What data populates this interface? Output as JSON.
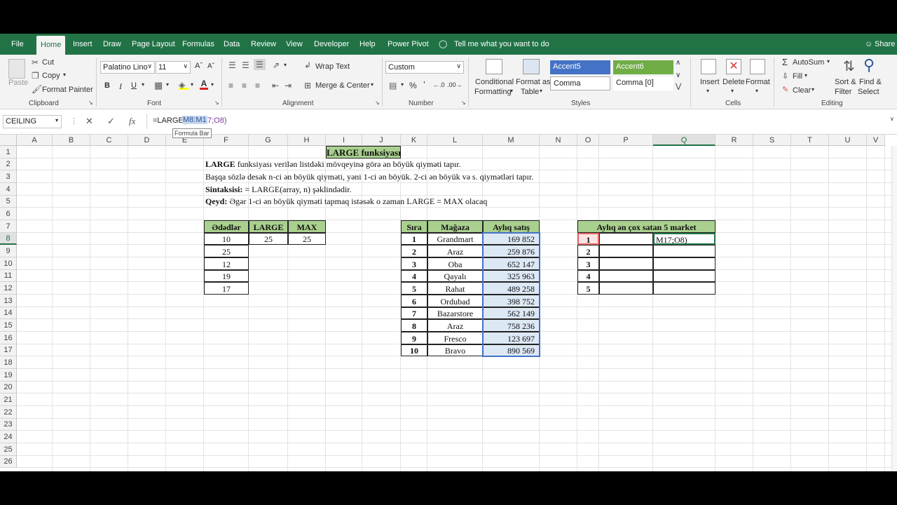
{
  "tabs": [
    "File",
    "Home",
    "Insert",
    "Draw",
    "Page Layout",
    "Formulas",
    "Data",
    "Review",
    "View",
    "Developer",
    "Help",
    "Power Pivot"
  ],
  "tell_me": "Tell me what you want to do",
  "share": "Share",
  "ribbon": {
    "clipboard": {
      "paste": "Paste",
      "cut": "Cut",
      "copy": "Copy",
      "format_painter": "Format Painter",
      "group": "Clipboard"
    },
    "font": {
      "name": "Palatino Lino",
      "size": "11",
      "bold": "B",
      "italic": "I",
      "underline": "U",
      "group": "Font"
    },
    "alignment": {
      "wrap": "Wrap Text",
      "merge": "Merge & Center",
      "group": "Alignment"
    },
    "number": {
      "format": "Custom",
      "group": "Number"
    },
    "styles": {
      "conditional": [
        "Conditional",
        "Formatting"
      ],
      "format_table": [
        "Format as",
        "Table"
      ],
      "accent5": "Accent5",
      "accent6": "Accent6",
      "comma": "Comma",
      "comma0": "Comma [0]",
      "group": "Styles"
    },
    "cells": {
      "insert": "Insert",
      "delete": "Delete",
      "format": "Format",
      "group": "Cells"
    },
    "editing": {
      "autosum": "AutoSum",
      "fill": "Fill",
      "clear": "Clear",
      "sort": [
        "Sort &",
        "Filter"
      ],
      "find": [
        "Find &",
        "Select"
      ],
      "group": "Editing"
    },
    "colors": {
      "accent5": "#4472c4",
      "accent6": "#70ad47",
      "green": "#217346"
    }
  },
  "formula_bar": {
    "name_box": "CEILING",
    "formula_pre": "=LARGE(",
    "formula_sel": "M8:M1",
    "formula_post": "7;O8)",
    "tooltip": "Formula Bar"
  },
  "columns": [
    "A",
    "B",
    "C",
    "D",
    "E",
    "F",
    "G",
    "H",
    "I",
    "J",
    "K",
    "L",
    "M",
    "N",
    "O",
    "P",
    "Q",
    "R",
    "S",
    "T",
    "U",
    "V"
  ],
  "rows": [
    "1",
    "2",
    "3",
    "4",
    "5",
    "6",
    "7",
    "8",
    "9",
    "10",
    "11",
    "12",
    "13",
    "14",
    "15",
    "16",
    "17",
    "18",
    "19",
    "20",
    "21",
    "22",
    "23",
    "24",
    "25",
    "26"
  ],
  "sheet": {
    "title": "LARGE funksiyası",
    "line2_bold": "LARGE",
    "line2": " funksiyası verilən listdəki mövqeyinə görə ən böyük qiyməti tapır.",
    "line3": "Başqa sözlə desək n-ci ən böyük qiyməti, yəni 1-ci ən böyük. 2-ci ən böyük və s. qiymətləri tapır.",
    "line4_bold": "Sintaksisi:",
    "line4": " = LARGE(array, n) şəklindədir.",
    "line5_bold": "Qeyd:",
    "line5": " Əgər 1-ci ən böyük qiyməti tapmaq istəsək o zaman LARGE = MAX olacaq",
    "t1": {
      "headers": [
        "Ədədlər",
        "LARGE",
        "MAX"
      ],
      "numbers": [
        "10",
        "25",
        "12",
        "19",
        "17"
      ],
      "large": "25",
      "max": "25"
    },
    "t2": {
      "headers": [
        "Sıra",
        "Mağaza",
        "Aylıq satış"
      ],
      "rows": [
        [
          "1",
          "Grandmart",
          "169 852"
        ],
        [
          "2",
          "Araz",
          "259 876"
        ],
        [
          "3",
          "Oba",
          "652 147"
        ],
        [
          "4",
          "Qayalı",
          "325 963"
        ],
        [
          "5",
          "Rahat",
          "489 258"
        ],
        [
          "6",
          "Ordubad",
          "398 752"
        ],
        [
          "7",
          "Bazarstore",
          "562 149"
        ],
        [
          "8",
          "Araz",
          "758 236"
        ],
        [
          "9",
          "Fresco",
          "123 697"
        ],
        [
          "10",
          "Bravo",
          "890 569"
        ]
      ]
    },
    "t3": {
      "title": "Aylıq ən çox satan 5 market",
      "ranks": [
        "1",
        "2",
        "3",
        "4",
        "5"
      ],
      "editing": "M17;O8)"
    }
  }
}
